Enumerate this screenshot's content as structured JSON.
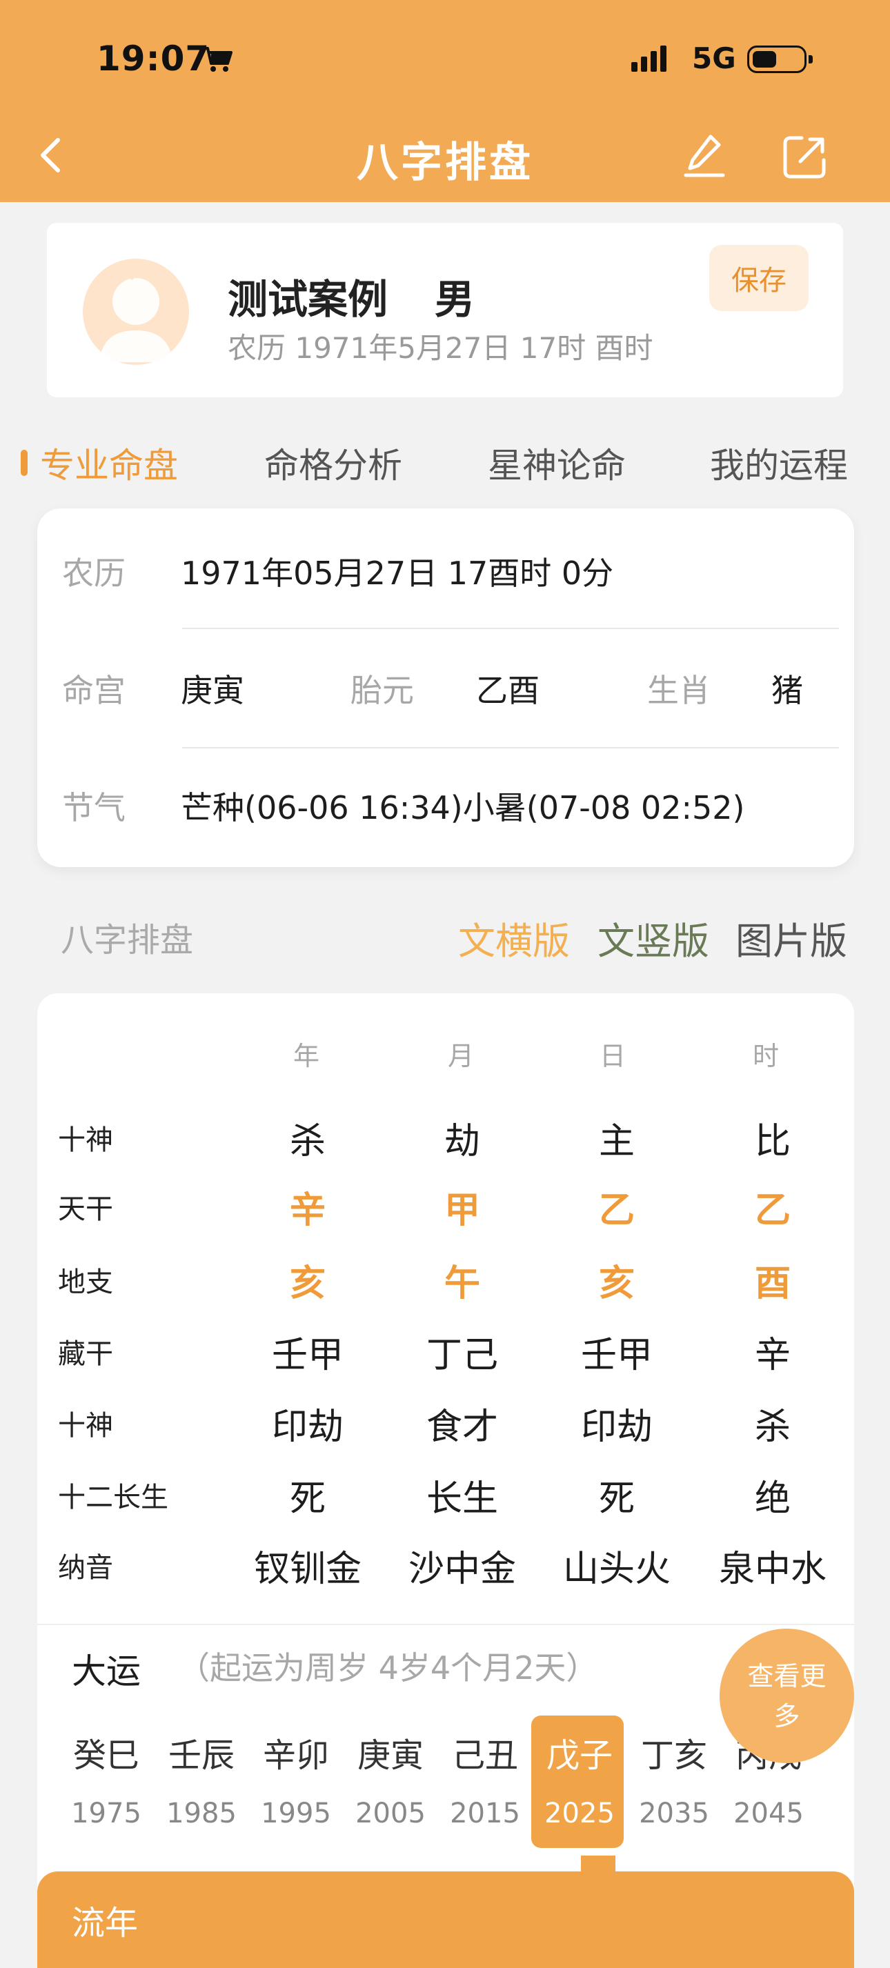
{
  "status_bar": {
    "time": "19:07",
    "network": "5G"
  },
  "nav": {
    "title": "八字排盘"
  },
  "user": {
    "name": "测试案例",
    "gender": "男",
    "date_line": "农历 1971年5月27日 17时 酉时",
    "save_label": "保存"
  },
  "tabs": [
    "专业命盘",
    "命格分析",
    "星神论命",
    "我的运程"
  ],
  "info": {
    "lunar_label": "农历",
    "lunar_value": "1971年05月27日 17酉时 0分",
    "minggong_label": "命宫",
    "minggong_value": "庚寅",
    "taiyuan_label": "胎元",
    "taiyuan_value": "乙酉",
    "shengxiao_label": "生肖",
    "shengxiao_value": "猪",
    "jieqi_label": "节气",
    "jieqi_value": "芒种(06-06 16:34)小暑(07-08 02:52)"
  },
  "section": {
    "title": "八字排盘",
    "versions": [
      "文横版",
      "文竖版",
      "图片版"
    ]
  },
  "bazi": {
    "columns": [
      "年",
      "月",
      "日",
      "时"
    ],
    "rows": [
      {
        "label": "十神",
        "values": [
          "杀",
          "劫",
          "主",
          "比"
        ]
      },
      {
        "label": "天干",
        "values": [
          "辛",
          "甲",
          "乙",
          "乙"
        ]
      },
      {
        "label": "地支",
        "values": [
          "亥",
          "午",
          "亥",
          "酉"
        ]
      },
      {
        "label": "藏干",
        "values": [
          "壬甲",
          "丁己",
          "壬甲",
          "辛"
        ]
      },
      {
        "label": "十神",
        "values": [
          "印劫",
          "食才",
          "印劫",
          "杀"
        ]
      },
      {
        "label": "十二长生",
        "values": [
          "死",
          "长生",
          "死",
          "绝"
        ]
      },
      {
        "label": "纳音",
        "values": [
          "钗钏金",
          "沙中金",
          "山头火",
          "泉中水"
        ]
      }
    ]
  },
  "dayun": {
    "title": "大运",
    "note": "（起运为周岁 4岁4个月2天）",
    "more_label": "查看更多",
    "items": [
      {
        "gz": "癸巳",
        "year": "1975"
      },
      {
        "gz": "壬辰",
        "year": "1985"
      },
      {
        "gz": "辛卯",
        "year": "1995"
      },
      {
        "gz": "庚寅",
        "year": "2005"
      },
      {
        "gz": "己丑",
        "year": "2015"
      },
      {
        "gz": "戊子",
        "year": "2025"
      },
      {
        "gz": "丁亥",
        "year": "2035"
      },
      {
        "gz": "丙戌",
        "year": "2045"
      }
    ],
    "active_index": 5
  },
  "liunian": {
    "label": "流年"
  },
  "colors": {
    "brand": "#f2aa55",
    "accent": "#ef9b3a"
  }
}
